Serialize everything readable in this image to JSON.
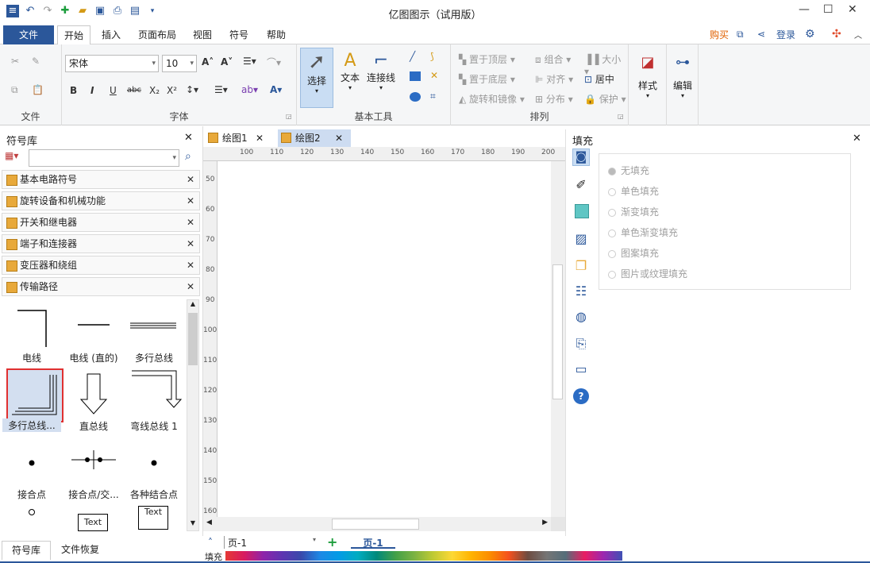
{
  "window": {
    "title": "亿图图示（试用版）"
  },
  "menu": {
    "file": "文件",
    "tabs": [
      "开始",
      "插入",
      "页面布局",
      "视图",
      "符号",
      "帮助"
    ],
    "buy": "购买",
    "login": "登录"
  },
  "ribbon": {
    "font_name": "宋体",
    "font_size": "10",
    "groups": {
      "file": "文件",
      "font": "字体",
      "tools": "基本工具",
      "arrange": "排列"
    },
    "tools": {
      "select": "选择",
      "text": "文本",
      "connector": "连接线"
    },
    "arrange": {
      "bring_front": "置于顶层",
      "send_back": "置于底层",
      "rotate": "旋转和镜像",
      "group": "组合",
      "align": "对齐",
      "distribute": "分布",
      "size": "大小",
      "center": "居中",
      "protect": "保护"
    },
    "style": "样式",
    "edit": "编辑"
  },
  "symbol_library": {
    "title": "符号库",
    "categories": [
      "基本电路符号",
      "旋转设备和机械功能",
      "开关和继电器",
      "端子和连接器",
      "变压器和绕组",
      "传输路径"
    ],
    "items": [
      "电线",
      "电线 (直的)",
      "多行总线",
      "多行总线...",
      "直总线",
      "弯线总线 1",
      "接合点",
      "接合点/交...",
      "各种结合点"
    ],
    "text_labels": [
      "Text",
      "Text"
    ]
  },
  "doc_tabs": [
    "绘图1",
    "绘图2"
  ],
  "ruler": {
    "h": [
      "100",
      "110",
      "120",
      "130",
      "140",
      "150",
      "160",
      "170",
      "180",
      "190",
      "200"
    ],
    "v": [
      "50",
      "60",
      "70",
      "80",
      "90",
      "100",
      "110",
      "120",
      "130",
      "140",
      "150",
      "160"
    ]
  },
  "fill_panel": {
    "title": "填充",
    "options": [
      "无填充",
      "单色填充",
      "渐变填充",
      "单色渐变填充",
      "图案填充",
      "图片或纹理填充"
    ]
  },
  "bottom": {
    "tabs": [
      "符号库",
      "文件恢复"
    ],
    "page_select": "页-1",
    "page_tab": "页-1",
    "fill_label": "填充"
  },
  "colors": {
    "accent": "#2b579a",
    "buy": "#e06000"
  }
}
